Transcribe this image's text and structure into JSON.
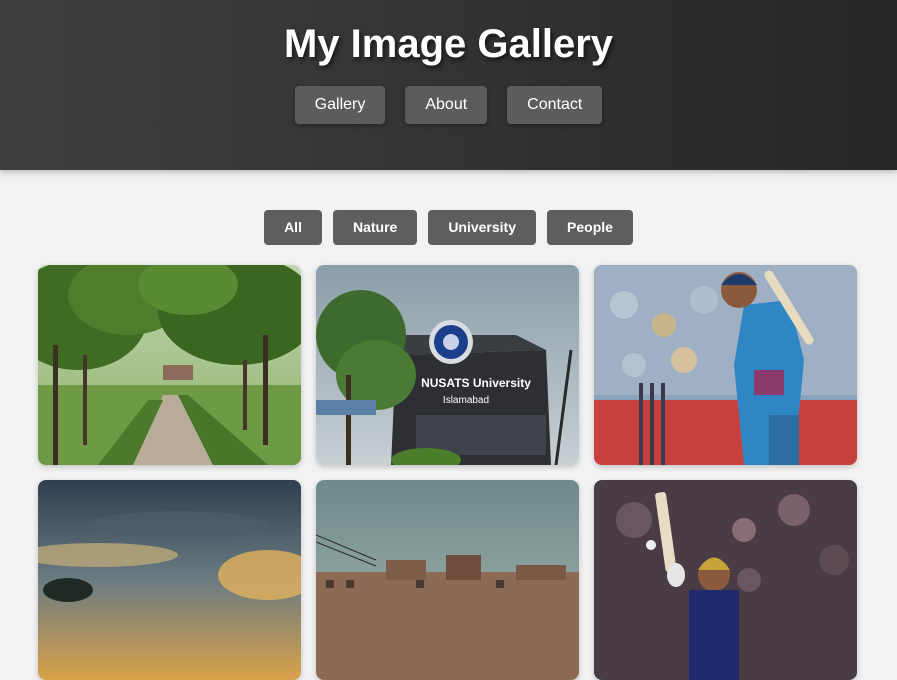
{
  "header": {
    "title": "My Image Gallery",
    "nav": [
      "Gallery",
      "About",
      "Contact"
    ]
  },
  "filters": [
    "All",
    "Nature",
    "University",
    "People"
  ],
  "gallery": {
    "photos": [
      {
        "subject": "tree-lined park path"
      },
      {
        "subject": "university building with sign",
        "sign_text": "NUSATS University",
        "sign_subtext": "Islamabad"
      },
      {
        "subject": "cricket batsman in blue kit"
      },
      {
        "subject": "sunset sky over trees"
      },
      {
        "subject": "city buildings under cloudy sky"
      },
      {
        "subject": "cricketer raising bat in stadium"
      }
    ]
  },
  "colors": {
    "header_bg": "#333333",
    "button_bg": "#5c5c5c",
    "page_bg": "#f2f2f2"
  }
}
